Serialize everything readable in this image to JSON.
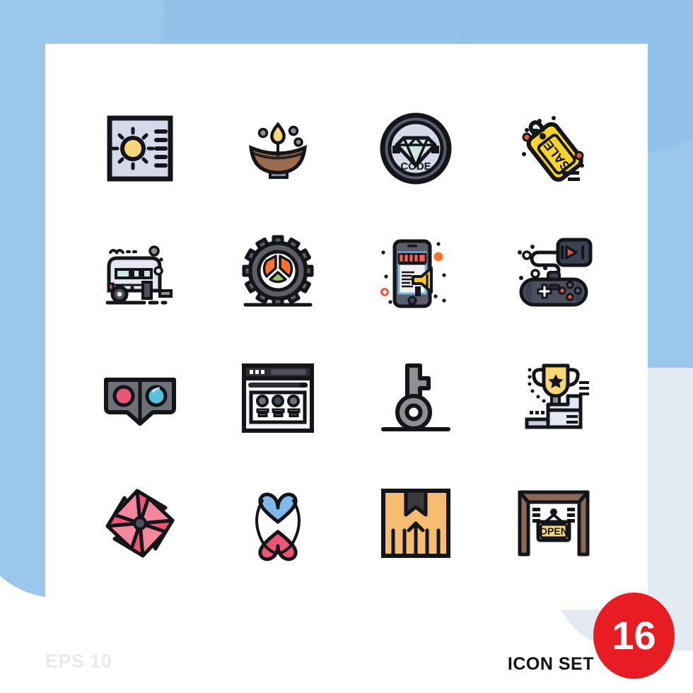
{
  "sheet": {
    "eps_label": "EPS 10",
    "icon_set_label": "ICON SET",
    "count_badge": "16"
  },
  "palette": {
    "background_blue": "#9CC7EC",
    "background_blue_soft": "#8FBFE8",
    "background_pale": "#E3EAF1",
    "sheet_white": "#FFFFFF",
    "outline": "#14151A",
    "badge_red": "#E81C23",
    "eps_gray": "#E8EAEC",
    "yellow": "#F9D778",
    "gold": "#F6CF50",
    "brown": "#A06A4B",
    "gray": "#8D8F94",
    "lavender": "#D5DAEA",
    "orange": "#F4742E",
    "pink": "#ED5575",
    "sky": "#5BC0DE",
    "sand": "#F6BD72",
    "green": "#9DBF6A",
    "mint": "#CFE6DE"
  },
  "icons": [
    {
      "index": 1,
      "row": 1,
      "col": 1,
      "name": "brightness-panel-icon",
      "label": "Brightness"
    },
    {
      "index": 2,
      "row": 1,
      "col": 2,
      "name": "diya-oil-lamp-icon",
      "label": "Diya Lamp"
    },
    {
      "index": 3,
      "row": 1,
      "col": 3,
      "name": "code-diamond-badge-icon",
      "label": "Code Badge",
      "text": "CODE"
    },
    {
      "index": 4,
      "row": 1,
      "col": 4,
      "name": "sale-tag-icon",
      "label": "Sale Tag",
      "text": "SALE"
    },
    {
      "index": 5,
      "row": 2,
      "col": 1,
      "name": "caravan-trailer-icon",
      "label": "Caravan"
    },
    {
      "index": 6,
      "row": 2,
      "col": 2,
      "name": "peace-gear-icon",
      "label": "Peace Gear"
    },
    {
      "index": 7,
      "row": 2,
      "col": 3,
      "name": "mobile-marketing-icon",
      "label": "Mobile Marketing"
    },
    {
      "index": 8,
      "row": 2,
      "col": 4,
      "name": "gamepad-console-icon",
      "label": "Gamepad"
    },
    {
      "index": 9,
      "row": 3,
      "col": 1,
      "name": "vr-cardboard-icon",
      "label": "VR Glasses"
    },
    {
      "index": 10,
      "row": 3,
      "col": 2,
      "name": "browser-team-page-icon",
      "label": "Team Webpage"
    },
    {
      "index": 11,
      "row": 3,
      "col": 3,
      "name": "key-icon",
      "label": "Key"
    },
    {
      "index": 12,
      "row": 3,
      "col": 4,
      "name": "trophy-podium-icon",
      "label": "Trophy Podium"
    },
    {
      "index": 13,
      "row": 4,
      "col": 1,
      "name": "pinwheel-icon",
      "label": "Pinwheel"
    },
    {
      "index": 14,
      "row": 4,
      "col": 2,
      "name": "two-hearts-icon",
      "label": "Two Hearts"
    },
    {
      "index": 15,
      "row": 4,
      "col": 3,
      "name": "delivery-box-icon",
      "label": "Delivery Box"
    },
    {
      "index": 16,
      "row": 4,
      "col": 4,
      "name": "open-sign-icon",
      "label": "Open Sign",
      "text": "OPEN"
    }
  ]
}
